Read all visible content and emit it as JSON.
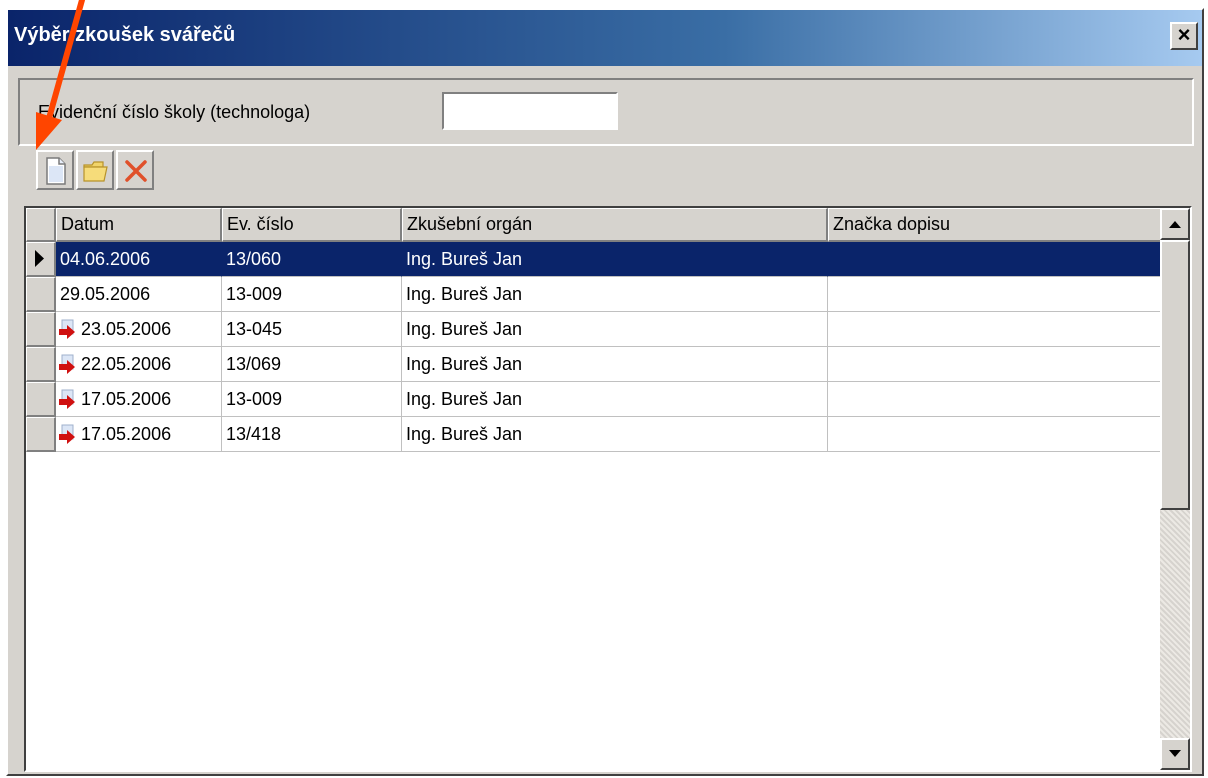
{
  "window": {
    "title": "Výběr zkoušek svářečů",
    "close_label": "×"
  },
  "form": {
    "label": "Evidenční číslo školy (technologa)",
    "input_value": ""
  },
  "toolbar": {
    "buttons": [
      "new-document-icon",
      "open-folder-icon",
      "delete-icon"
    ]
  },
  "grid": {
    "columns": [
      "Datum",
      "Ev. číslo",
      "Zkušební orgán",
      "Značka dopisu"
    ],
    "rows": [
      {
        "datum": "04.06.2006",
        "ev": "13/060",
        "organ": "Ing. Bureš Jan",
        "znacka": "",
        "selected": true,
        "linked": false
      },
      {
        "datum": "29.05.2006",
        "ev": "13-009",
        "organ": "Ing. Bureš Jan",
        "znacka": "",
        "selected": false,
        "linked": false
      },
      {
        "datum": "23.05.2006",
        "ev": "13-045",
        "organ": "Ing. Bureš Jan",
        "znacka": "",
        "selected": false,
        "linked": true
      },
      {
        "datum": "22.05.2006",
        "ev": "13/069",
        "organ": "Ing. Bureš Jan",
        "znacka": "",
        "selected": false,
        "linked": true
      },
      {
        "datum": "17.05.2006",
        "ev": "13-009",
        "organ": "Ing. Bureš Jan",
        "znacka": "",
        "selected": false,
        "linked": true
      },
      {
        "datum": "17.05.2006",
        "ev": "13/418",
        "organ": "Ing. Bureš Jan",
        "znacka": "",
        "selected": false,
        "linked": true
      }
    ]
  },
  "colors": {
    "titlebar": "#0a246a",
    "selection": "#0a246a",
    "annotation_arrow": "#ff4500",
    "row_link_arrow": "#d01010"
  }
}
